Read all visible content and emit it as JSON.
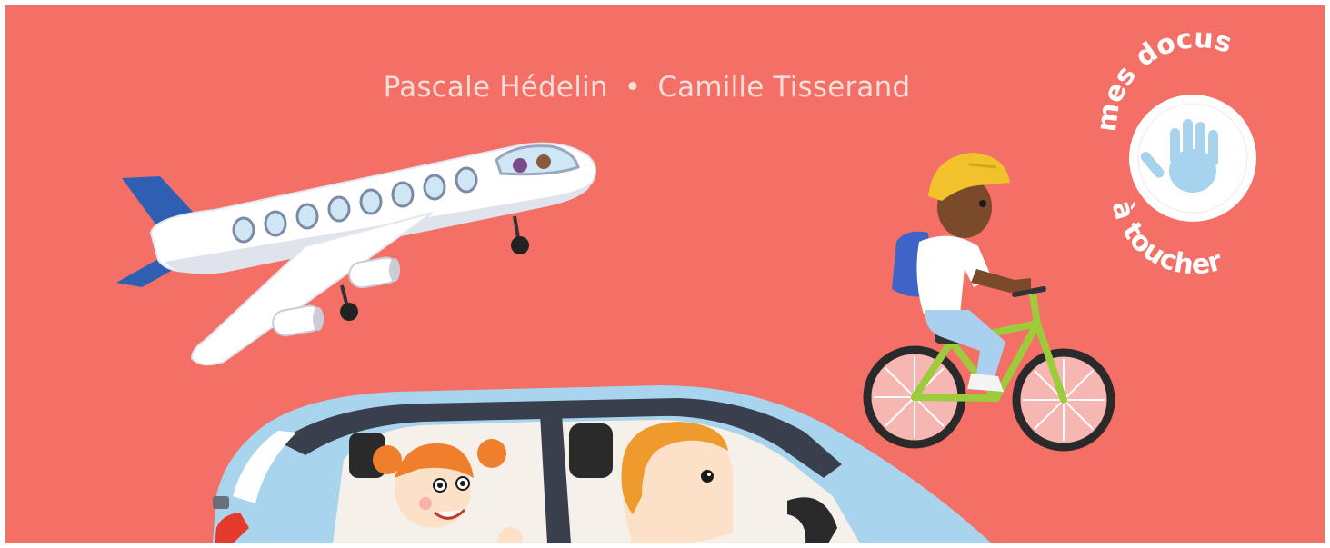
{
  "cover": {
    "background_color": "#f46f66",
    "author_1": "Pascale Hédelin",
    "separator": "•",
    "author_2": "Camille Tisserand"
  },
  "badge": {
    "text_top": "mes docus",
    "text_bottom": "à toucher",
    "icon": "hand-icon"
  },
  "illustrations": [
    "airplane",
    "cyclist",
    "car"
  ]
}
